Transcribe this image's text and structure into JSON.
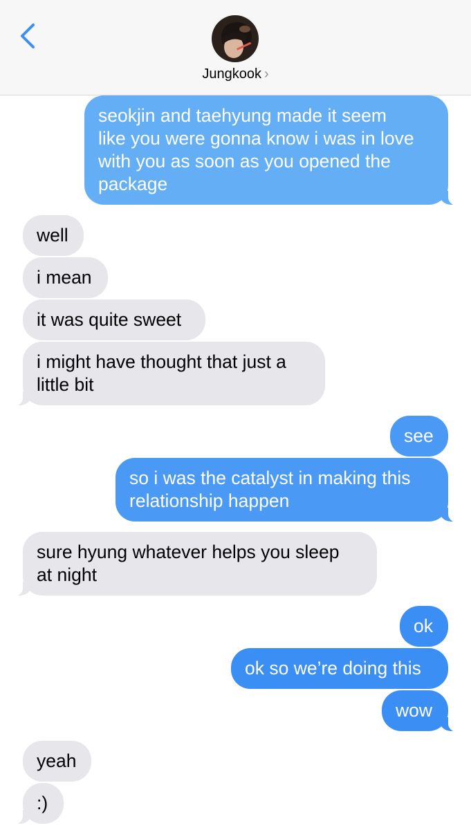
{
  "header": {
    "contact_name": "Jungkook",
    "back_icon": "chevron-left-icon",
    "detail_icon": "chevron-right-icon",
    "accent_color": "#3b8ef3"
  },
  "messages": [
    {
      "from": "me",
      "text": "seokjin and taehyung made it seem like you were gonna know i was in love with you as soon as you opened the package",
      "lines": [
        "seokjin and taehyung made it seem",
        "like you were gonna know i was in love",
        "with you as soon as you opened the",
        "package"
      ]
    },
    {
      "from": "them",
      "text": "well"
    },
    {
      "from": "them",
      "text": "i mean"
    },
    {
      "from": "them",
      "text": "it was quite sweet"
    },
    {
      "from": "them",
      "text": "i might have thought that just a little bit",
      "lines": [
        "i might have thought that just a",
        "little bit"
      ]
    },
    {
      "from": "me",
      "text": "see"
    },
    {
      "from": "me",
      "text": "so i was the catalyst in making this relationship happen",
      "lines": [
        "so i was the catalyst in making this",
        "relationship happen"
      ]
    },
    {
      "from": "them",
      "text": "sure hyung whatever helps you sleep at night",
      "lines": [
        "sure hyung whatever helps you sleep",
        "at night"
      ]
    },
    {
      "from": "me",
      "text": "ok"
    },
    {
      "from": "me",
      "text": "ok so we’re doing this"
    },
    {
      "from": "me",
      "text": "wow"
    },
    {
      "from": "them",
      "text": "yeah"
    },
    {
      "from": "them",
      "text": ":)"
    }
  ],
  "colors": {
    "sent_bubble": "#3b8ef3",
    "received_bubble": "#e6e6eb",
    "header_background": "#f7f7f7"
  }
}
